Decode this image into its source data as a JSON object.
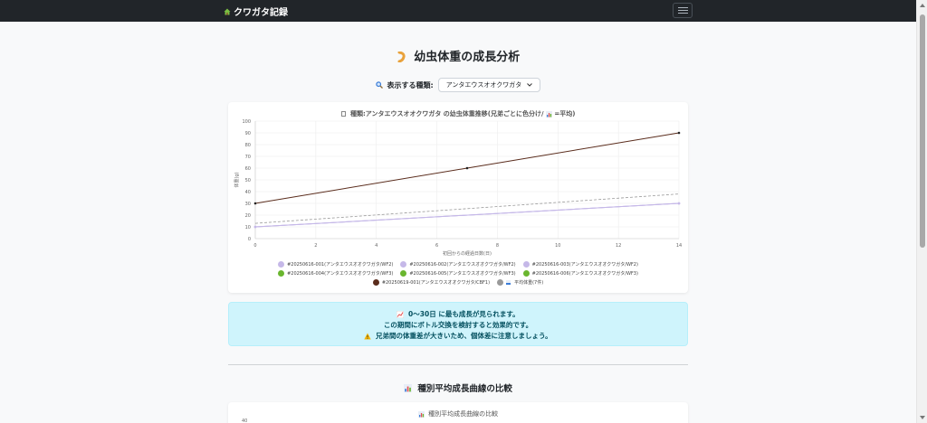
{
  "navbar": {
    "brand": "クワガタ記録",
    "brand_icon": "house-icon",
    "menu_icon": "hamburger-icon"
  },
  "page": {
    "title": "幼虫体重の成長分析",
    "title_icon": "larva-icon",
    "species_label": "表示する種類:",
    "species_label_icon": "magnifier-icon",
    "species_selected": "アンタエウスオオクワガタ"
  },
  "chart": {
    "title": "種類:アンタエウスオオクワガタ の幼虫体重推移(兄弟ごとに色分け/",
    "title_suffix": "=平均)",
    "title_icon": "document-icon",
    "title_suffix_icon": "bar-chart-icon"
  },
  "chart_data": {
    "type": "line",
    "title": "種類:アンタエウスオオクワガタ の幼虫体重推移(兄弟ごとに色分け/📊=平均)",
    "xlabel": "初回からの経過日数(日)",
    "ylabel": "体重(g)",
    "xlim": [
      0,
      14
    ],
    "ylim": [
      0,
      100
    ],
    "x_ticks": [
      "0",
      "2",
      "4",
      "6",
      "8",
      "10",
      "12",
      "14"
    ],
    "y_ticks": [
      "0",
      "10",
      "20",
      "30",
      "40",
      "50",
      "60",
      "70",
      "80",
      "90",
      "100"
    ],
    "grid": true,
    "legend_position": "bottom",
    "series": [
      {
        "name": "#20250616-001(アンタエウスオオクワガタ/WF2)",
        "color": "#c5b8e8",
        "x": [
          0,
          14
        ],
        "y": [
          10,
          30
        ],
        "style": "solid"
      },
      {
        "name": "#20250616-002(アンタエウスオオクワガタ/WF2)",
        "color": "#c5b8e8",
        "x": [
          0,
          14
        ],
        "y": [
          10,
          30
        ],
        "style": "solid"
      },
      {
        "name": "#20250616-003(アンタエウスオオクワガタ/WF2)",
        "color": "#c5b8e8",
        "x": [
          0,
          14
        ],
        "y": [
          10,
          30
        ],
        "style": "solid"
      },
      {
        "name": "#20250616-004(アンタエウスオオクワガタ/WF3)",
        "color": "#6ab62f",
        "x": [],
        "y": [],
        "style": "solid"
      },
      {
        "name": "#20250616-005(アンタエウスオオクワガタ/WF3)",
        "color": "#6ab62f",
        "x": [],
        "y": [],
        "style": "solid"
      },
      {
        "name": "#20250616-006(アンタエウスオオクワガタ/WF3)",
        "color": "#6ab62f",
        "x": [],
        "y": [],
        "style": "solid"
      },
      {
        "name": "#20250619-001(アンタエウスオオクワガタ/CBF1)",
        "color": "#5a2c1c",
        "x": [
          0,
          7,
          14
        ],
        "y": [
          30,
          60,
          90
        ],
        "style": "solid"
      },
      {
        "name": "平均体重(7件)",
        "color": "#999999",
        "x": [
          0,
          14
        ],
        "y": [
          13,
          38
        ],
        "style": "dashed",
        "icon": "bar-chart-icon"
      }
    ]
  },
  "alert": {
    "line1": "0〜30日 に最も成長が見られます。",
    "line1_icon": "chart-up-icon",
    "line2": "この期間にボトル交換を検討すると効果的です。",
    "line3": "兄弟間の体重差が大きいため、個体差に注意しましょう。",
    "line3_icon": "warning-icon"
  },
  "section2": {
    "title": "種別平均成長曲線の比較",
    "title_icon": "bar-chart-icon",
    "chart_title": "種別平均成長曲線の比較",
    "chart_title_icon": "bar-chart-icon",
    "first_tick": "40"
  }
}
